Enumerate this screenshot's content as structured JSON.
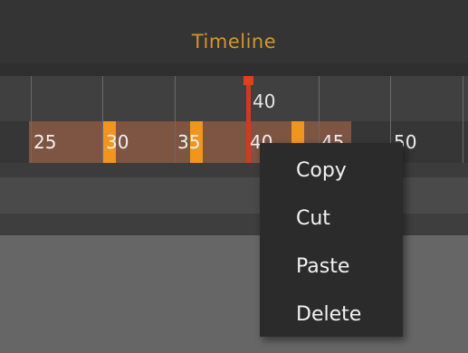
{
  "panel": {
    "title": "Timeline",
    "title_color": "#d4962c"
  },
  "timeline": {
    "current_frame": "40",
    "tick_labels": [
      "25",
      "30",
      "35",
      "40",
      "45",
      "50"
    ],
    "selection_color": "#7e5442",
    "keyframe_color": "#f0961e",
    "playhead_color": "#cf3b1f"
  },
  "context_menu": {
    "items": [
      "Copy",
      "Cut",
      "Paste",
      "Delete"
    ]
  }
}
